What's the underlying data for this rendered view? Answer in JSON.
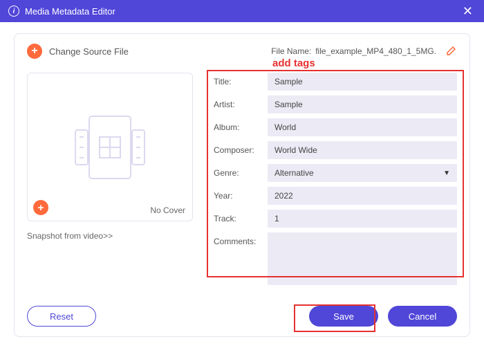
{
  "titlebar": {
    "title": "Media Metadata Editor"
  },
  "header": {
    "change_source": "Change Source File",
    "filename_label": "File Name:",
    "filename_value": "file_example_MP4_480_1_5MG."
  },
  "cover": {
    "no_cover": "No Cover",
    "snapshot": "Snapshot from video>>"
  },
  "callout": "add tags",
  "fields": {
    "title_label": "Title:",
    "title_value": "Sample",
    "artist_label": "Artist:",
    "artist_value": "Sample",
    "album_label": "Album:",
    "album_value": "World",
    "composer_label": "Composer:",
    "composer_value": "World Wide",
    "genre_label": "Genre:",
    "genre_value": "Alternative",
    "year_label": "Year:",
    "year_value": "2022",
    "track_label": "Track:",
    "track_value": "1",
    "comments_label": "Comments:",
    "comments_value": ""
  },
  "buttons": {
    "reset": "Reset",
    "save": "Save",
    "cancel": "Cancel"
  }
}
